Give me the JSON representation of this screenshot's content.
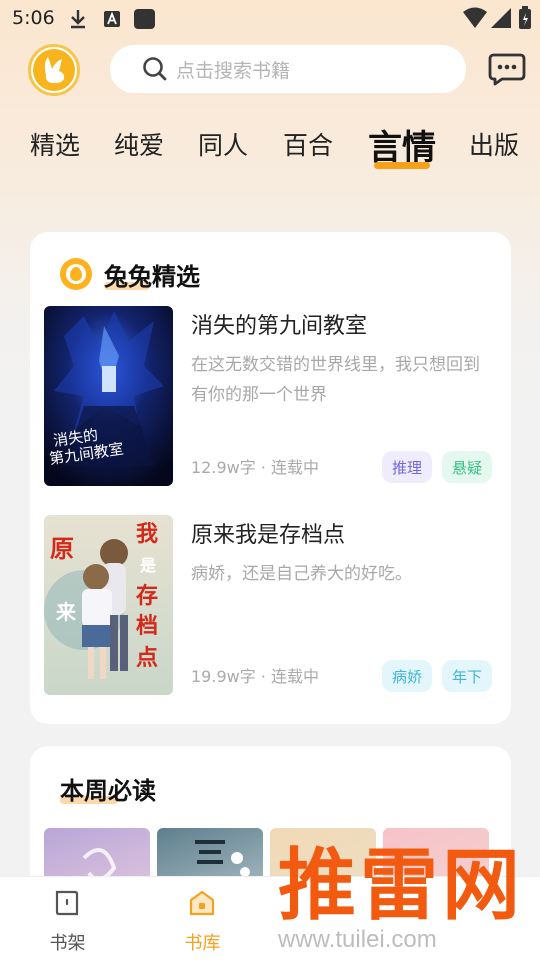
{
  "status_bar": {
    "time": "5:06"
  },
  "header": {
    "search_placeholder": "点击搜索书籍"
  },
  "tabs": [
    {
      "label": "精选"
    },
    {
      "label": "纯爱"
    },
    {
      "label": "同人"
    },
    {
      "label": "百合"
    },
    {
      "label": "言情",
      "active": true
    },
    {
      "label": "出版"
    }
  ],
  "featured": {
    "title": "兔兔精选",
    "books": [
      {
        "title": "消失的第九间教室",
        "desc": "在这无数交错的世界线里，我只想回到有你的那一个世界",
        "meta": "12.9w字 · 连载中",
        "tags": [
          "推理",
          "悬疑"
        ],
        "cover_text": "消失的第九间教室"
      },
      {
        "title": "原来我是存档点",
        "desc": "病娇，还是自己养大的好吃。",
        "meta": "19.9w字 · 连载中",
        "tags": [
          "病娇",
          "年下"
        ],
        "cover_text": [
          "原",
          "来",
          "我",
          "是",
          "存",
          "档",
          "点"
        ]
      }
    ]
  },
  "weekly": {
    "title": "本周必读"
  },
  "bottom_nav": [
    {
      "label": "书架",
      "icon": "book-icon"
    },
    {
      "label": "书库",
      "icon": "library-icon",
      "active": true
    },
    {
      "label": "",
      "icon": ""
    },
    {
      "label": "",
      "icon": ""
    }
  ],
  "watermark": {
    "big": "推雷网",
    "url": "www.tuilei.com"
  },
  "colors": {
    "accent": "#f7a11a",
    "watermark": "#f25a0f"
  }
}
